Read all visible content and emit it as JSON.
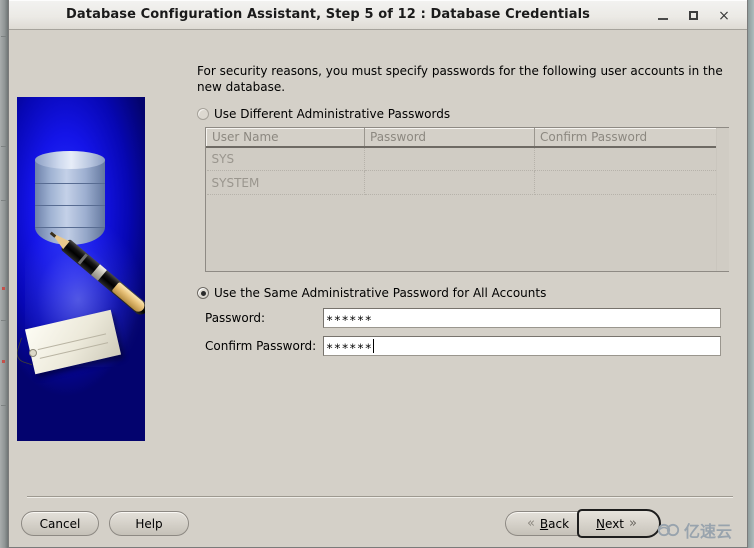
{
  "window": {
    "title": "Database Configuration Assistant, Step 5 of 12 : Database Credentials",
    "minimize_label": "_",
    "maximize_label": "□",
    "close_label": "×"
  },
  "banner": {
    "alt": "oracle-database-signing-illustration"
  },
  "main": {
    "intro": "For security reasons, you must specify passwords for the following user accounts in the new database.",
    "option_different": "Use Different Administrative Passwords",
    "option_same": "Use the Same Administrative Password for All Accounts",
    "selected_option": "same",
    "table": {
      "columns": [
        "User Name",
        "Password",
        "Confirm Password"
      ],
      "rows": [
        [
          "SYS",
          "",
          ""
        ],
        [
          "SYSTEM",
          "",
          ""
        ]
      ],
      "enabled": false
    },
    "password_label": "Password:",
    "password_value": "∗∗∗∗∗∗",
    "confirm_label": "Confirm Password:",
    "confirm_value": "∗∗∗∗∗∗",
    "focused_field": "confirm-password-field"
  },
  "footer": {
    "cancel": "Cancel",
    "help": "Help",
    "back": "Back",
    "back_mnemonic": "B",
    "next": "Next",
    "next_mnemonic": "N",
    "back_chevron": "«",
    "next_chevron": "»",
    "default_button": "next-button"
  },
  "watermark": {
    "text": "亿速云",
    "color": "#98a3ad"
  }
}
